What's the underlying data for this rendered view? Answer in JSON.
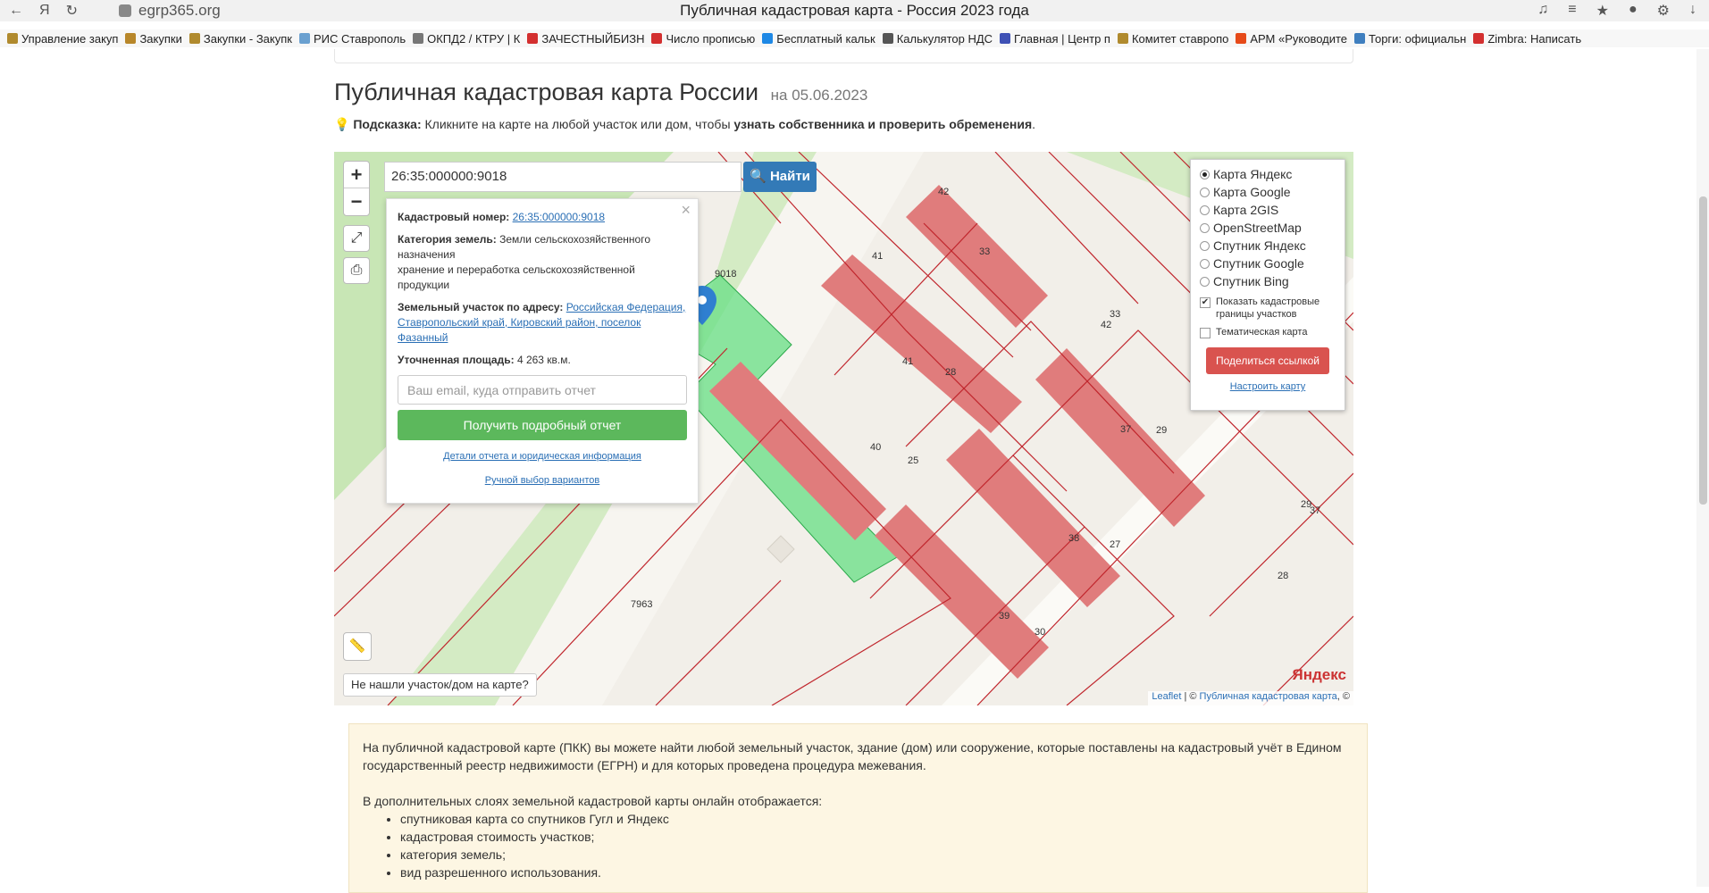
{
  "browser": {
    "address": "egrp365.org",
    "window_title": "Публичная кадастровая карта - Россия 2023 года",
    "bookmarks": [
      {
        "label": "Управление закуп",
        "icon": "emblem-icon",
        "color": "#b08a2e"
      },
      {
        "label": "Закупки",
        "icon": "eagle-icon",
        "color": "#b8872a"
      },
      {
        "label": "Закупки - Закупк",
        "icon": "emblem-icon",
        "color": "#b08a2e"
      },
      {
        "label": "РИС Ставрополь",
        "icon": "cloud-icon",
        "color": "#6aa0d0"
      },
      {
        "label": "ОКПД2 / КТРУ | К",
        "icon": "document-icon",
        "color": "#777777"
      },
      {
        "label": "ЗАЧЕСТНЫЙБИЗН",
        "icon": "za-icon",
        "color": "#d32f2f"
      },
      {
        "label": "Число прописью",
        "icon": "n-icon",
        "color": "#d32f2f"
      },
      {
        "label": "Бесплатный кальк",
        "icon": "calc-icon",
        "color": "#1e88e5"
      },
      {
        "label": "Калькулятор НДС",
        "icon": "grid-icon",
        "color": "#555555"
      },
      {
        "label": "Главная | Центр п",
        "icon": "people-icon",
        "color": "#3f51b5"
      },
      {
        "label": "Комитет ставропо",
        "icon": "emblem-icon",
        "color": "#b08a2e"
      },
      {
        "label": "АРМ «Руководите",
        "icon": "globe-icon",
        "color": "#e64a19"
      },
      {
        "label": "Торги: официальн",
        "icon": "gear-icon",
        "color": "#3f7fbf"
      },
      {
        "label": "Zimbra: Написать",
        "icon": "zimbra-icon",
        "color": "#d32f2f"
      }
    ]
  },
  "page": {
    "title": "Публичная кадастровая карта России",
    "date": "на 05.06.2023",
    "hint_label": "Подсказка:",
    "hint_text": "Кликните на карте на любой участок или дом, чтобы",
    "hint_bold": "узнать собственника и проверить обременения",
    "hint_end": "."
  },
  "map": {
    "search_value": "26:35:000000:9018",
    "find_label": "Найти",
    "popup": {
      "cad_label": "Кадастровый номер:",
      "cad_value": "26:35:000000:9018",
      "cat_label": "Категория земель:",
      "cat_value": "Земли сельскохозяйственного назначения",
      "cat_use": "хранение и переработка сельскохозяйственной продукции",
      "addr_label": "Земельный участок по адресу:",
      "addr_value": "Российская Федерация, Ставропольский край, Кировский район, поселок Фазанный",
      "area_label": "Уточненная площадь:",
      "area_value": "4 263 кв.м.",
      "email_placeholder": "Ваш email, куда отправить отчет",
      "report_button": "Получить подробный отчет",
      "details_link": "Детали отчета и юридическая информация",
      "manual_link": "Ручной выбор вариантов"
    },
    "layers": {
      "options": [
        "Карта Яндекс",
        "Карта Google",
        "Карта 2GIS",
        "OpenStreetMap",
        "Спутник Яндекс",
        "Спутник Google",
        "Спутник Bing"
      ],
      "selected": "Карта Яндекс",
      "show_borders": "Показать кадастровые границы участков",
      "thematic": "Тематическая карта",
      "share": "Поделиться ссылкой",
      "configure": "Настроить карту"
    },
    "not_found": "Не нашли участок/дом на карте?",
    "yandex": "Яндекс",
    "attribution_leaflet": "Leaflet",
    "attribution_pkk": "Публичная кадастровая карта",
    "labels": {
      "parcel": "9018",
      "l41a": "41",
      "l41b": "41",
      "l42": "42",
      "l33a": "33",
      "l33b": "33",
      "l42b": "42",
      "l28": "28",
      "l40": "40",
      "l25": "25",
      "l37": "37",
      "l29": "29",
      "l29b": "29",
      "l37b": "37",
      "l38": "38",
      "l27": "27",
      "l39": "39",
      "l30": "30",
      "l7963": "7963",
      "l28b": "28"
    }
  },
  "info": {
    "p1": "На публичной кадастровой карте (ПКК) вы можете найти любой земельный участок, здание (дом) или сооружение, которые поставлены на кадастровый учёт в Едином государственный реестр недвижимости (ЕГРН) и для которых проведена процедура межевания.",
    "p2": "В дополнительных слоях земельной кадастровой карты онлайн отображается:",
    "items": [
      "спутниковая карта со спутников Гугл и Яндекс",
      "кадастровая стоимость участков;",
      "категория земель;",
      "вид разрешенного использования."
    ]
  }
}
